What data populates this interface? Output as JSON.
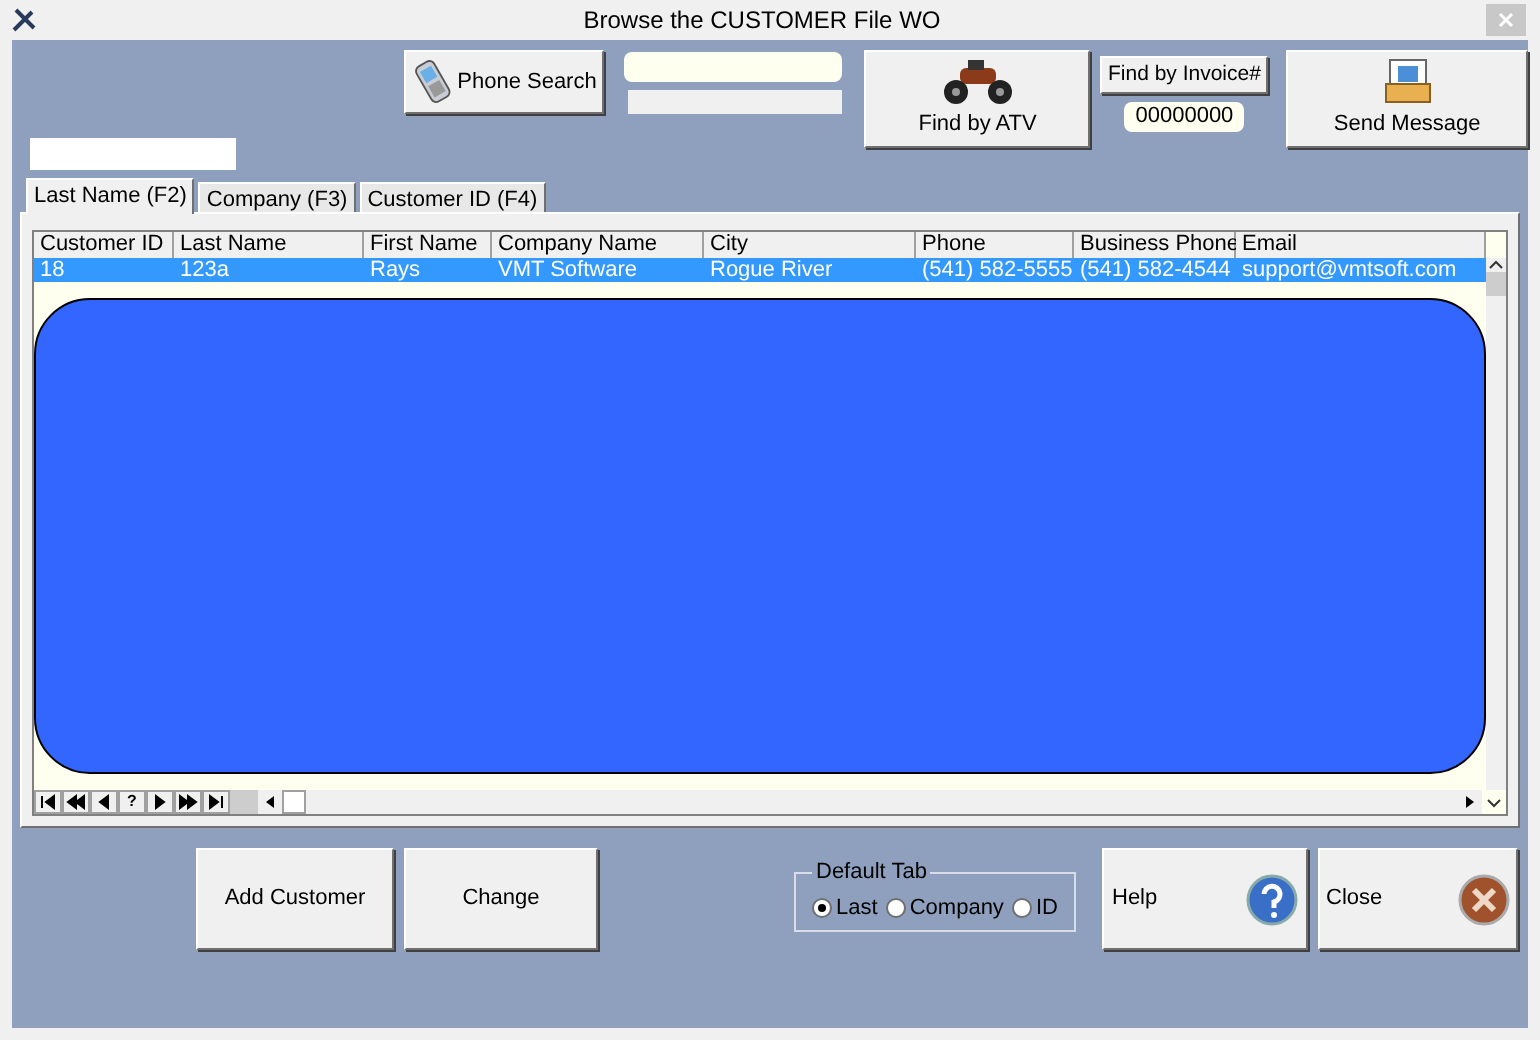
{
  "window": {
    "title": "Browse the CUSTOMER File WO"
  },
  "toolbar": {
    "phone_search": "Phone Search",
    "find_atv": "Find by ATV",
    "find_invoice": "Find by Invoice#",
    "invoice_value": "00000000",
    "send_message": "Send Message"
  },
  "tabs": [
    {
      "label": "Last Name (F2)",
      "selected": true
    },
    {
      "label": "Company (F3)",
      "selected": false
    },
    {
      "label": "Customer ID (F4)",
      "selected": false
    }
  ],
  "table": {
    "columns": [
      "Customer ID",
      "Last Name",
      "First Name",
      "Company Name",
      "City",
      "Phone",
      "Business Phone",
      "Email"
    ],
    "rows": [
      {
        "selected": true,
        "cells": [
          "18",
          "123a",
          "Rays",
          "VMT Software",
          "Rogue River",
          "(541) 582-5555",
          "(541) 582-4544",
          "support@vmtsoft.com"
        ]
      }
    ]
  },
  "record_nav": [
    {
      "kind": "first"
    },
    {
      "kind": "prev_page"
    },
    {
      "kind": "prev"
    },
    {
      "kind": "text",
      "label": "?"
    },
    {
      "kind": "next"
    },
    {
      "kind": "next_page"
    },
    {
      "kind": "last"
    }
  ],
  "buttons": {
    "add": "Add Customer",
    "change": "Change",
    "help": "Help",
    "close": "Close"
  },
  "default_tab": {
    "title": "Default Tab",
    "options": [
      {
        "label": "Last",
        "selected": true
      },
      {
        "label": "Company",
        "selected": false
      },
      {
        "label": "ID",
        "selected": false
      }
    ]
  }
}
